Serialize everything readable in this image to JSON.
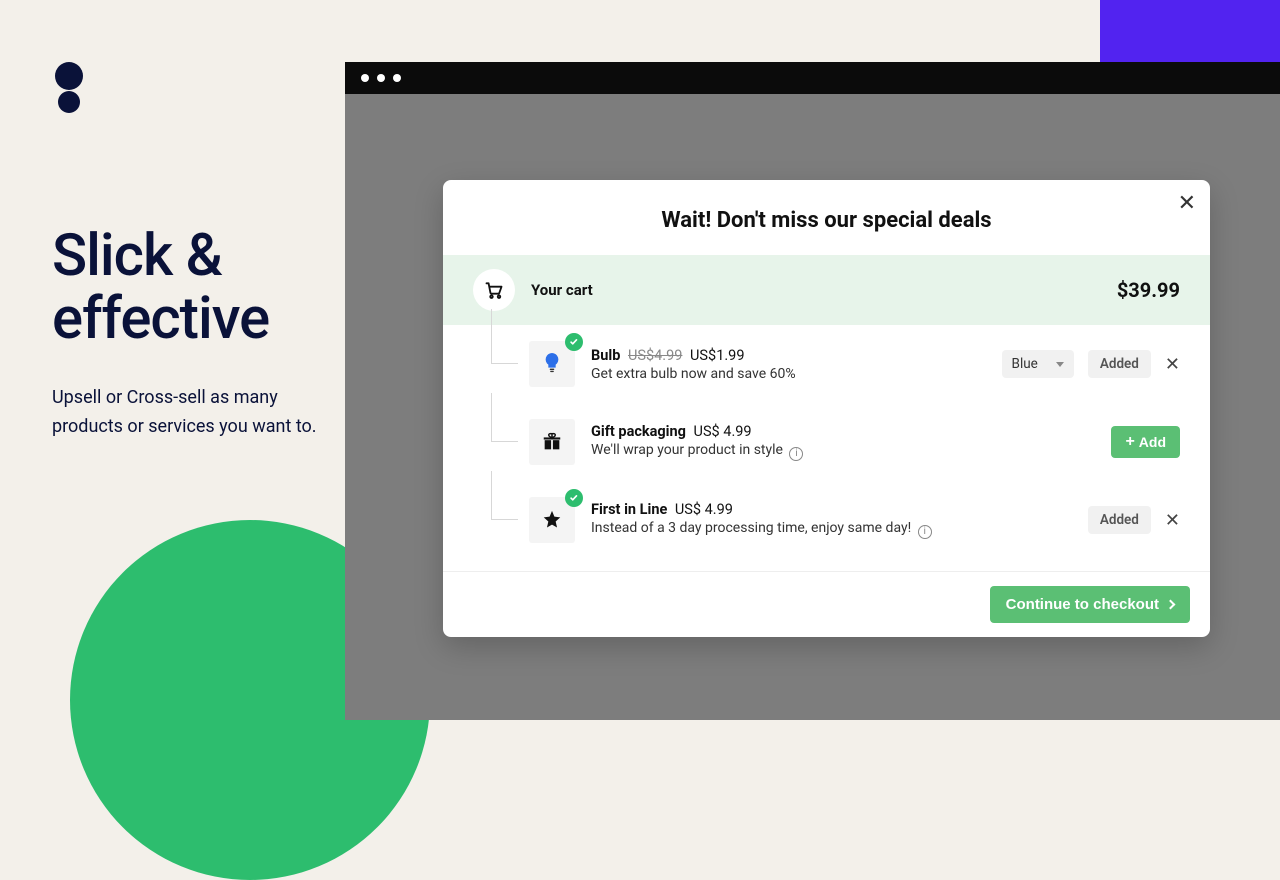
{
  "hero": {
    "headline": "Slick & effective",
    "sub": "Upsell or Cross-sell as many products or services you want to."
  },
  "modal": {
    "title": "Wait! Don't miss our special deals",
    "cart_label": "Your cart",
    "cart_total": "$39.99",
    "checkout_label": "Continue to checkout",
    "add_label": "Add",
    "added_label": "Added",
    "items": [
      {
        "name": "Bulb",
        "orig_price": "US$4.99",
        "price": "US$1.99",
        "desc": "Get extra bulb now and save 60%",
        "variant": "Blue",
        "added": true
      },
      {
        "name": "Gift packaging",
        "price": "US$ 4.99",
        "desc": "We'll wrap your product in style",
        "added": false
      },
      {
        "name": "First in Line",
        "price": "US$ 4.99",
        "desc": "Instead of a 3 day processing time, enjoy same day!",
        "added": true
      }
    ]
  }
}
